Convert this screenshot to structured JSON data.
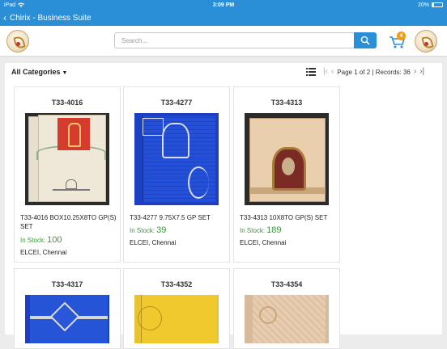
{
  "status_bar": {
    "device": "iPad",
    "time": "3:09 PM",
    "battery": "20%"
  },
  "nav": {
    "title": "Chirix - Business Suite"
  },
  "search": {
    "placeholder": "Search..."
  },
  "cart": {
    "count": "4"
  },
  "filter": {
    "category_label": "All Categories"
  },
  "pager": {
    "info": "Page 1 of 2 | Records: 36"
  },
  "products": [
    {
      "code": "T33-4016",
      "title": "T33-4016 BOX10.25X8TO GP(S) SET",
      "stock_label": "In Stock:",
      "stock_qty": "100",
      "vendor": "ELCEI, Chennai"
    },
    {
      "code": "T33-4277",
      "title": "T33-4277 9.75X7.5 GP SET",
      "stock_label": "In Stock:",
      "stock_qty": "39",
      "vendor": "ELCEI, Chennai"
    },
    {
      "code": "T33-4313",
      "title": "T33-4313 10X8TO GP(S) SET",
      "stock_label": "In Stock:",
      "stock_qty": "189",
      "vendor": "ELCEI, Chennai"
    },
    {
      "code": "T33-4317"
    },
    {
      "code": "T33-4352"
    },
    {
      "code": "T33-4354"
    }
  ],
  "colors": {
    "accent": "#2a8fd6",
    "in_stock": "#3a9a3a",
    "badge": "#f39c12"
  }
}
